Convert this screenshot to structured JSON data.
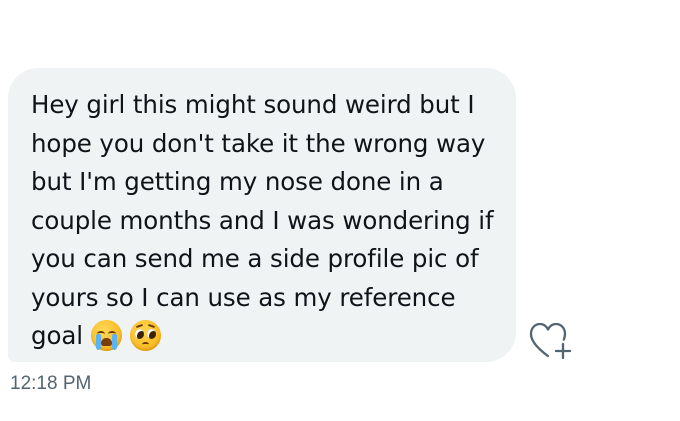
{
  "message": {
    "text": "Hey girl this might sound weird but I hope you don't take it the wrong way but I'm getting my nose done in a couple months and I was wondering if you can send me a side profile pic of yours so I can use as my reference goal",
    "emojis": [
      "loudly-crying-face",
      "pleading-face"
    ],
    "timestamp": "12:18 PM",
    "bubble_color": "#eff3f4",
    "text_color": "#0f1419"
  },
  "actions": {
    "react_icon": "heart-plus-icon"
  },
  "colors": {
    "background": "#ffffff",
    "timestamp": "#536471",
    "icon": "#536471"
  }
}
